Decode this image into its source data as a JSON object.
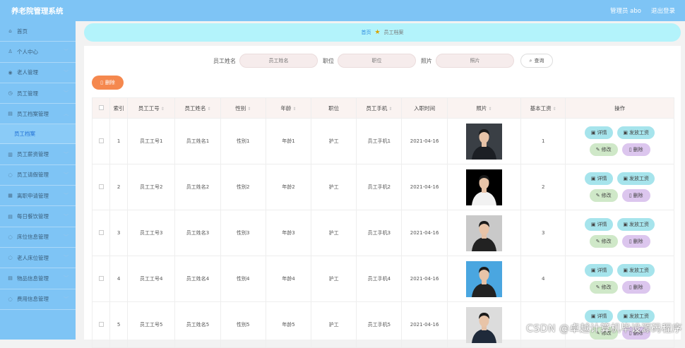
{
  "header": {
    "title": "养老院管理系统",
    "user_label": "管理员 abo",
    "logout_label": "退出登录"
  },
  "sidebar": {
    "items": [
      {
        "label": "首页",
        "icon": "home-icon",
        "chevron": false
      },
      {
        "label": "个人中心",
        "icon": "user-icon",
        "chevron": true
      },
      {
        "label": "老人管理",
        "icon": "location-icon",
        "chevron": true
      },
      {
        "label": "员工管理",
        "icon": "clock-icon",
        "chevron": true
      },
      {
        "label": "员工档案管理",
        "icon": "folder-icon",
        "chevron": true,
        "expanded": true
      },
      {
        "label": "员工薪资管理",
        "icon": "bar-chart-icon",
        "chevron": true
      },
      {
        "label": "员工请假管理",
        "icon": "circle-icon",
        "chevron": true
      },
      {
        "label": "离职申请管理",
        "icon": "grid-icon",
        "chevron": true
      },
      {
        "label": "每日餐饮管理",
        "icon": "folder-icon",
        "chevron": true
      },
      {
        "label": "床位信息管理",
        "icon": "circle-icon",
        "chevron": true
      },
      {
        "label": "老人床位管理",
        "icon": "circle-icon",
        "chevron": true
      },
      {
        "label": "物品信息管理",
        "icon": "folder-icon",
        "chevron": true
      },
      {
        "label": "费用信息管理",
        "icon": "circle-icon",
        "chevron": true
      }
    ],
    "sub_item": "员工档案"
  },
  "breadcrumb": {
    "home": "首页",
    "current": "员工档案"
  },
  "search": {
    "name_label": "员工姓名",
    "name_placeholder": "员工姓名",
    "position_label": "职位",
    "position_placeholder": "职位",
    "photo_label": "照片",
    "photo_placeholder": "照片",
    "query_label": "查询"
  },
  "toolbar": {
    "delete_label": "删除"
  },
  "table": {
    "headers": [
      "索引",
      "员工工号",
      "员工姓名",
      "性别",
      "年龄",
      "职位",
      "员工手机",
      "入职时间",
      "照片",
      "基本工资",
      "操作"
    ],
    "rows": [
      {
        "idx": "1",
        "no": "员工工号1",
        "name": "员工姓名1",
        "gender": "性别1",
        "age": "年龄1",
        "pos": "护工",
        "phone": "员工手机1",
        "date": "2021-04-16",
        "salary": "1"
      },
      {
        "idx": "2",
        "no": "员工工号2",
        "name": "员工姓名2",
        "gender": "性别2",
        "age": "年龄2",
        "pos": "护工",
        "phone": "员工手机2",
        "date": "2021-04-16",
        "salary": "2"
      },
      {
        "idx": "3",
        "no": "员工工号3",
        "name": "员工姓名3",
        "gender": "性别3",
        "age": "年龄3",
        "pos": "护工",
        "phone": "员工手机3",
        "date": "2021-04-16",
        "salary": "3"
      },
      {
        "idx": "4",
        "no": "员工工号4",
        "name": "员工姓名4",
        "gender": "性别4",
        "age": "年龄4",
        "pos": "护工",
        "phone": "员工手机4",
        "date": "2021-04-16",
        "salary": "4"
      },
      {
        "idx": "5",
        "no": "员工工号5",
        "name": "员工姓名5",
        "gender": "性别5",
        "age": "年龄5",
        "pos": "护工",
        "phone": "员工手机5",
        "date": "2021-04-16",
        "salary": ""
      }
    ],
    "actions": {
      "detail": "详情",
      "pay": "发放工资",
      "edit": "修改",
      "delete": "删除"
    }
  },
  "watermark": "CSDN @卓越计算机毕设源码程序",
  "colors": {
    "topbar": "#7ec4f5",
    "breadcrumb_bg": "#b3f3fb",
    "delete_btn": "#f5884e",
    "detail_btn": "#a6e4ec",
    "edit_btn": "#cfe8c8",
    "del_btn": "#dcc6ee"
  }
}
